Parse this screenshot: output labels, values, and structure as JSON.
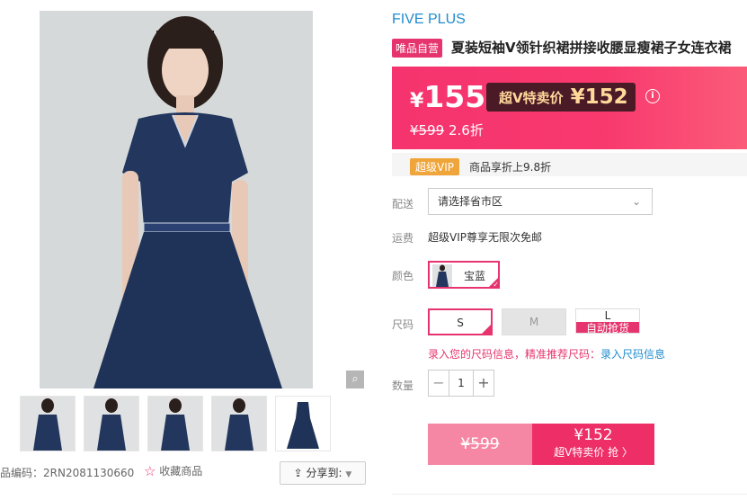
{
  "gallery": {
    "zoom_icon": "magnifier-icon",
    "thumbnails": [
      "thumb-1",
      "thumb-2",
      "thumb-3",
      "thumb-4",
      "thumb-5"
    ]
  },
  "product_code": {
    "label": "品编码：",
    "value": "2RN2081130660"
  },
  "favorite": {
    "icon": "star-icon",
    "label": "收藏商品"
  },
  "share": {
    "icon": "share-icon",
    "label": "分享到:"
  },
  "brand": "FIVE PLUS",
  "badge": "唯品自营",
  "title": "夏装短袖V领针织裙拼接收腰显瘦裙子女连衣裙",
  "price": {
    "currency": "¥",
    "sale": "155",
    "vip_label": "超V特卖价",
    "vip_price": "¥152",
    "original": "¥599",
    "discount": "2.6折"
  },
  "vip": {
    "tag": "超级VIP",
    "desc": "商品享折上9.8折"
  },
  "shipping": {
    "label": "配送",
    "placeholder": "请选择省市区"
  },
  "freight": {
    "label": "运费",
    "text": "超级VIP尊享无限次免邮"
  },
  "color": {
    "label": "颜色",
    "selected": "宝蓝"
  },
  "size": {
    "label": "尺码",
    "options": [
      "S",
      "M",
      "L"
    ],
    "selected": "S",
    "rush_label": "自动抢货",
    "tip_prefix": "录入您的尺码信息，精准推荐尺码：",
    "tip_link": "录入尺码信息"
  },
  "quantity": {
    "label": "数量",
    "value": "1",
    "minus": "−",
    "plus": "+"
  },
  "buy": {
    "orig_price": "¥599",
    "vip_price": "¥152",
    "vip_action": "超V特卖价 抢 〉"
  },
  "colors": {
    "accent": "#e6356e",
    "brand": "#1f8ccf",
    "vip_gold": "#ffd89a"
  }
}
